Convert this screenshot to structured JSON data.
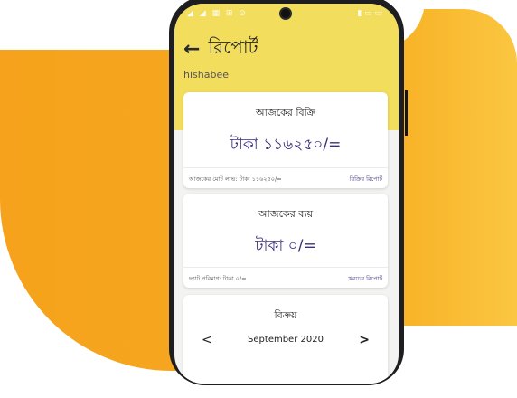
{
  "status": {
    "left_icons": "◢ ◢ ▦ ⊞ ⊙",
    "right_icons": "▮ ▭ ▭"
  },
  "header": {
    "back_icon": "←",
    "title": "রিপোর্ট",
    "subtitle": "hishabee"
  },
  "sales_card": {
    "title": "আজকের বিক্রি",
    "amount": "টাকা ১১৬২৫০/=",
    "footer_left": "আজকের মোট লাভ: টাকা ১১৬২৫০/=",
    "footer_link": "বিক্রির রিপোর্ট"
  },
  "expense_card": {
    "title": "আজকের ব্যয়",
    "amount": "টাকা ০/=",
    "footer_left": "ভ্যাট পরিমাণ: টাকা ০/=",
    "footer_link": "খরচের রিপোর্ট"
  },
  "sales_section": {
    "title": "বিক্রয়",
    "prev_icon": "<",
    "month": "September 2020",
    "next_icon": ">"
  },
  "colors": {
    "header_bg": "#f2dd5d",
    "accent": "#3a2e7a",
    "background_blob": "#f6a21c"
  }
}
